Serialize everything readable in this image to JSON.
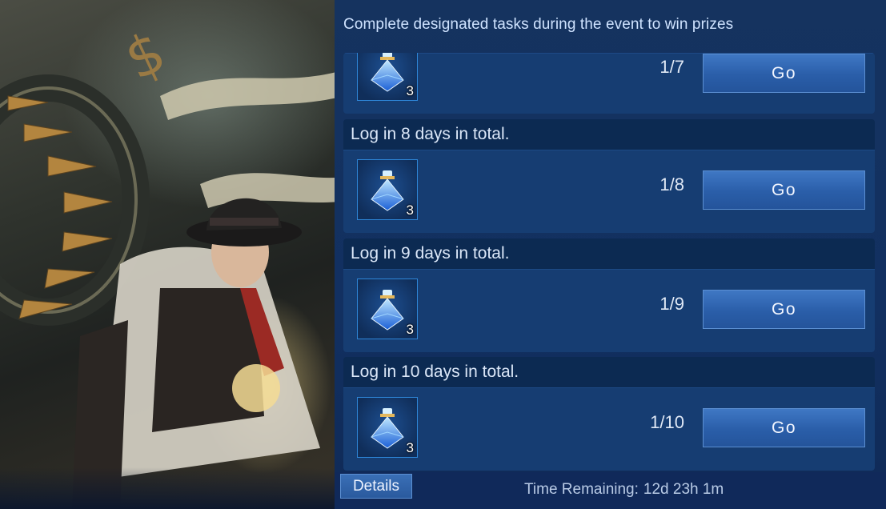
{
  "header": {
    "text": "Complete designated tasks during the event to win prizes"
  },
  "tasks": [
    {
      "title": "",
      "progress": "1/7",
      "reward_qty": "3",
      "reward_icon": "blue-crystal-potion-icon",
      "button": "Go"
    },
    {
      "title": "Log in 8 days in total.",
      "progress": "1/8",
      "reward_qty": "3",
      "reward_icon": "blue-crystal-potion-icon",
      "button": "Go"
    },
    {
      "title": "Log in 9 days in total.",
      "progress": "1/9",
      "reward_qty": "3",
      "reward_icon": "blue-crystal-potion-icon",
      "button": "Go"
    },
    {
      "title": "Log in 10 days in total.",
      "progress": "1/10",
      "reward_qty": "3",
      "reward_icon": "blue-crystal-potion-icon",
      "button": "Go"
    }
  ],
  "footer": {
    "details_label": "Details",
    "time_label": "Time Remaining:",
    "time_value": "12d 23h 1m"
  },
  "colors": {
    "accent": "#2e86d8",
    "panel": "#163d72",
    "button": "#2a5ea9"
  }
}
